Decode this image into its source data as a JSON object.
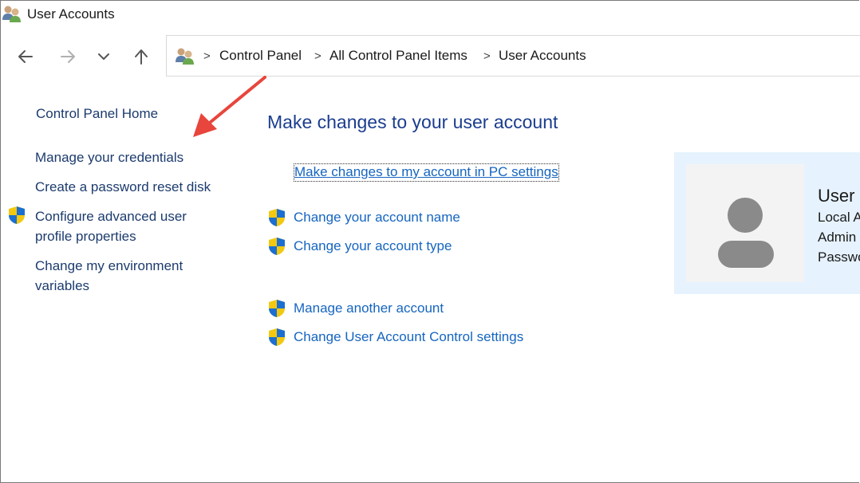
{
  "window": {
    "title": "User Accounts"
  },
  "nav": {
    "back": "back-arrow-icon",
    "forward": "forward-arrow-icon",
    "recent": "chevron-down-icon",
    "up": "up-arrow-icon"
  },
  "breadcrumb": {
    "items": [
      "Control Panel",
      "All Control Panel Items",
      "User Accounts"
    ],
    "separator": ">"
  },
  "sidebar": {
    "home": "Control Panel Home",
    "links": [
      {
        "label": "Manage your credentials"
      },
      {
        "label": "Create a password reset disk"
      },
      {
        "label_line1": "Configure advanced user",
        "label_line2": "profile properties",
        "icon": "uac-shield-icon"
      },
      {
        "label_line1": "Change my environment",
        "label_line2": "variables"
      }
    ]
  },
  "main": {
    "heading": "Make changes to your user account",
    "pc_settings_link": "Make changes to my account in PC settings",
    "links": [
      {
        "label": "Change your account name",
        "icon": "uac-shield-icon"
      },
      {
        "label": "Change your account type",
        "icon": "uac-shield-icon"
      },
      {
        "label": "Manage another account",
        "icon": "uac-shield-icon"
      },
      {
        "label": "Change User Account Control settings",
        "icon": "uac-shield-icon"
      }
    ]
  },
  "user_card": {
    "name": "User",
    "line1": "Local A",
    "line2": "Admin",
    "line3": "Passwo"
  },
  "colors": {
    "link": "#1565c0",
    "heading": "#1b3d8f",
    "card_bg": "#e6f2fd",
    "annotation": "#e8453c"
  }
}
